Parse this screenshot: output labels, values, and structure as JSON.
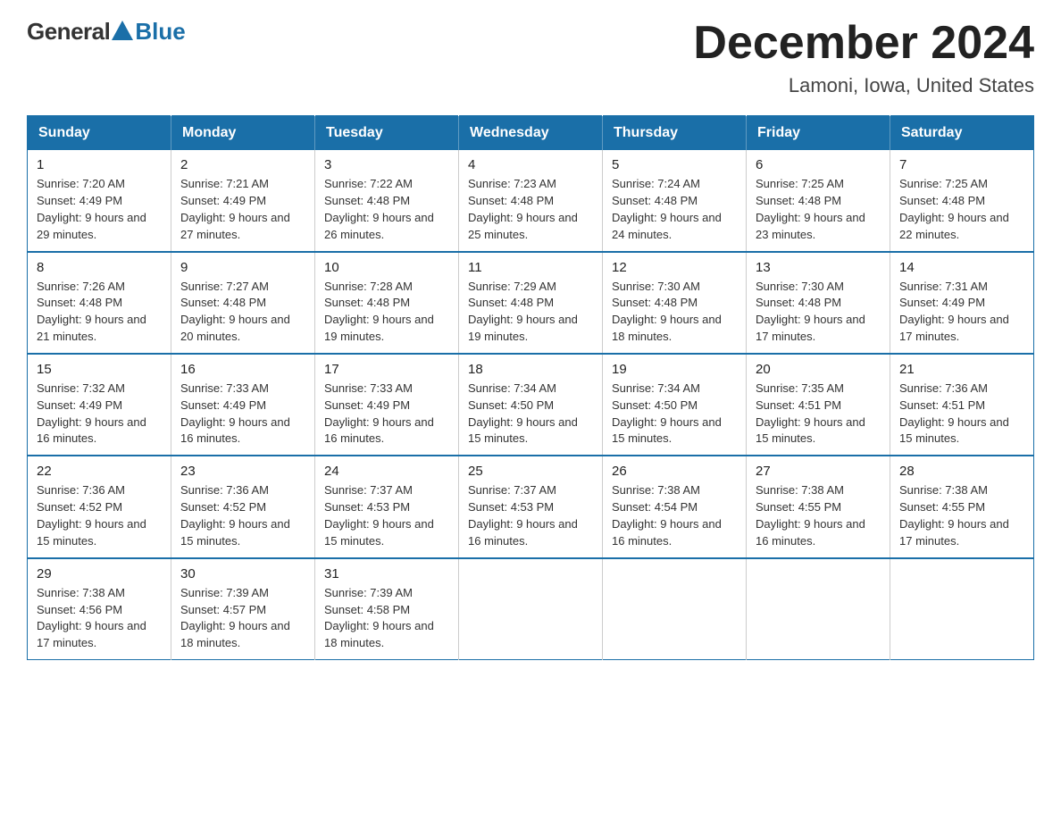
{
  "logo": {
    "general": "General",
    "blue": "Blue",
    "triangle": "▲"
  },
  "header": {
    "month_title": "December 2024",
    "location": "Lamoni, Iowa, United States"
  },
  "weekdays": [
    "Sunday",
    "Monday",
    "Tuesday",
    "Wednesday",
    "Thursday",
    "Friday",
    "Saturday"
  ],
  "weeks": [
    [
      {
        "day": "1",
        "sunrise": "7:20 AM",
        "sunset": "4:49 PM",
        "daylight": "9 hours and 29 minutes."
      },
      {
        "day": "2",
        "sunrise": "7:21 AM",
        "sunset": "4:49 PM",
        "daylight": "9 hours and 27 minutes."
      },
      {
        "day": "3",
        "sunrise": "7:22 AM",
        "sunset": "4:48 PM",
        "daylight": "9 hours and 26 minutes."
      },
      {
        "day": "4",
        "sunrise": "7:23 AM",
        "sunset": "4:48 PM",
        "daylight": "9 hours and 25 minutes."
      },
      {
        "day": "5",
        "sunrise": "7:24 AM",
        "sunset": "4:48 PM",
        "daylight": "9 hours and 24 minutes."
      },
      {
        "day": "6",
        "sunrise": "7:25 AM",
        "sunset": "4:48 PM",
        "daylight": "9 hours and 23 minutes."
      },
      {
        "day": "7",
        "sunrise": "7:25 AM",
        "sunset": "4:48 PM",
        "daylight": "9 hours and 22 minutes."
      }
    ],
    [
      {
        "day": "8",
        "sunrise": "7:26 AM",
        "sunset": "4:48 PM",
        "daylight": "9 hours and 21 minutes."
      },
      {
        "day": "9",
        "sunrise": "7:27 AM",
        "sunset": "4:48 PM",
        "daylight": "9 hours and 20 minutes."
      },
      {
        "day": "10",
        "sunrise": "7:28 AM",
        "sunset": "4:48 PM",
        "daylight": "9 hours and 19 minutes."
      },
      {
        "day": "11",
        "sunrise": "7:29 AM",
        "sunset": "4:48 PM",
        "daylight": "9 hours and 19 minutes."
      },
      {
        "day": "12",
        "sunrise": "7:30 AM",
        "sunset": "4:48 PM",
        "daylight": "9 hours and 18 minutes."
      },
      {
        "day": "13",
        "sunrise": "7:30 AM",
        "sunset": "4:48 PM",
        "daylight": "9 hours and 17 minutes."
      },
      {
        "day": "14",
        "sunrise": "7:31 AM",
        "sunset": "4:49 PM",
        "daylight": "9 hours and 17 minutes."
      }
    ],
    [
      {
        "day": "15",
        "sunrise": "7:32 AM",
        "sunset": "4:49 PM",
        "daylight": "9 hours and 16 minutes."
      },
      {
        "day": "16",
        "sunrise": "7:33 AM",
        "sunset": "4:49 PM",
        "daylight": "9 hours and 16 minutes."
      },
      {
        "day": "17",
        "sunrise": "7:33 AM",
        "sunset": "4:49 PM",
        "daylight": "9 hours and 16 minutes."
      },
      {
        "day": "18",
        "sunrise": "7:34 AM",
        "sunset": "4:50 PM",
        "daylight": "9 hours and 15 minutes."
      },
      {
        "day": "19",
        "sunrise": "7:34 AM",
        "sunset": "4:50 PM",
        "daylight": "9 hours and 15 minutes."
      },
      {
        "day": "20",
        "sunrise": "7:35 AM",
        "sunset": "4:51 PM",
        "daylight": "9 hours and 15 minutes."
      },
      {
        "day": "21",
        "sunrise": "7:36 AM",
        "sunset": "4:51 PM",
        "daylight": "9 hours and 15 minutes."
      }
    ],
    [
      {
        "day": "22",
        "sunrise": "7:36 AM",
        "sunset": "4:52 PM",
        "daylight": "9 hours and 15 minutes."
      },
      {
        "day": "23",
        "sunrise": "7:36 AM",
        "sunset": "4:52 PM",
        "daylight": "9 hours and 15 minutes."
      },
      {
        "day": "24",
        "sunrise": "7:37 AM",
        "sunset": "4:53 PM",
        "daylight": "9 hours and 15 minutes."
      },
      {
        "day": "25",
        "sunrise": "7:37 AM",
        "sunset": "4:53 PM",
        "daylight": "9 hours and 16 minutes."
      },
      {
        "day": "26",
        "sunrise": "7:38 AM",
        "sunset": "4:54 PM",
        "daylight": "9 hours and 16 minutes."
      },
      {
        "day": "27",
        "sunrise": "7:38 AM",
        "sunset": "4:55 PM",
        "daylight": "9 hours and 16 minutes."
      },
      {
        "day": "28",
        "sunrise": "7:38 AM",
        "sunset": "4:55 PM",
        "daylight": "9 hours and 17 minutes."
      }
    ],
    [
      {
        "day": "29",
        "sunrise": "7:38 AM",
        "sunset": "4:56 PM",
        "daylight": "9 hours and 17 minutes."
      },
      {
        "day": "30",
        "sunrise": "7:39 AM",
        "sunset": "4:57 PM",
        "daylight": "9 hours and 18 minutes."
      },
      {
        "day": "31",
        "sunrise": "7:39 AM",
        "sunset": "4:58 PM",
        "daylight": "9 hours and 18 minutes."
      },
      null,
      null,
      null,
      null
    ]
  ]
}
